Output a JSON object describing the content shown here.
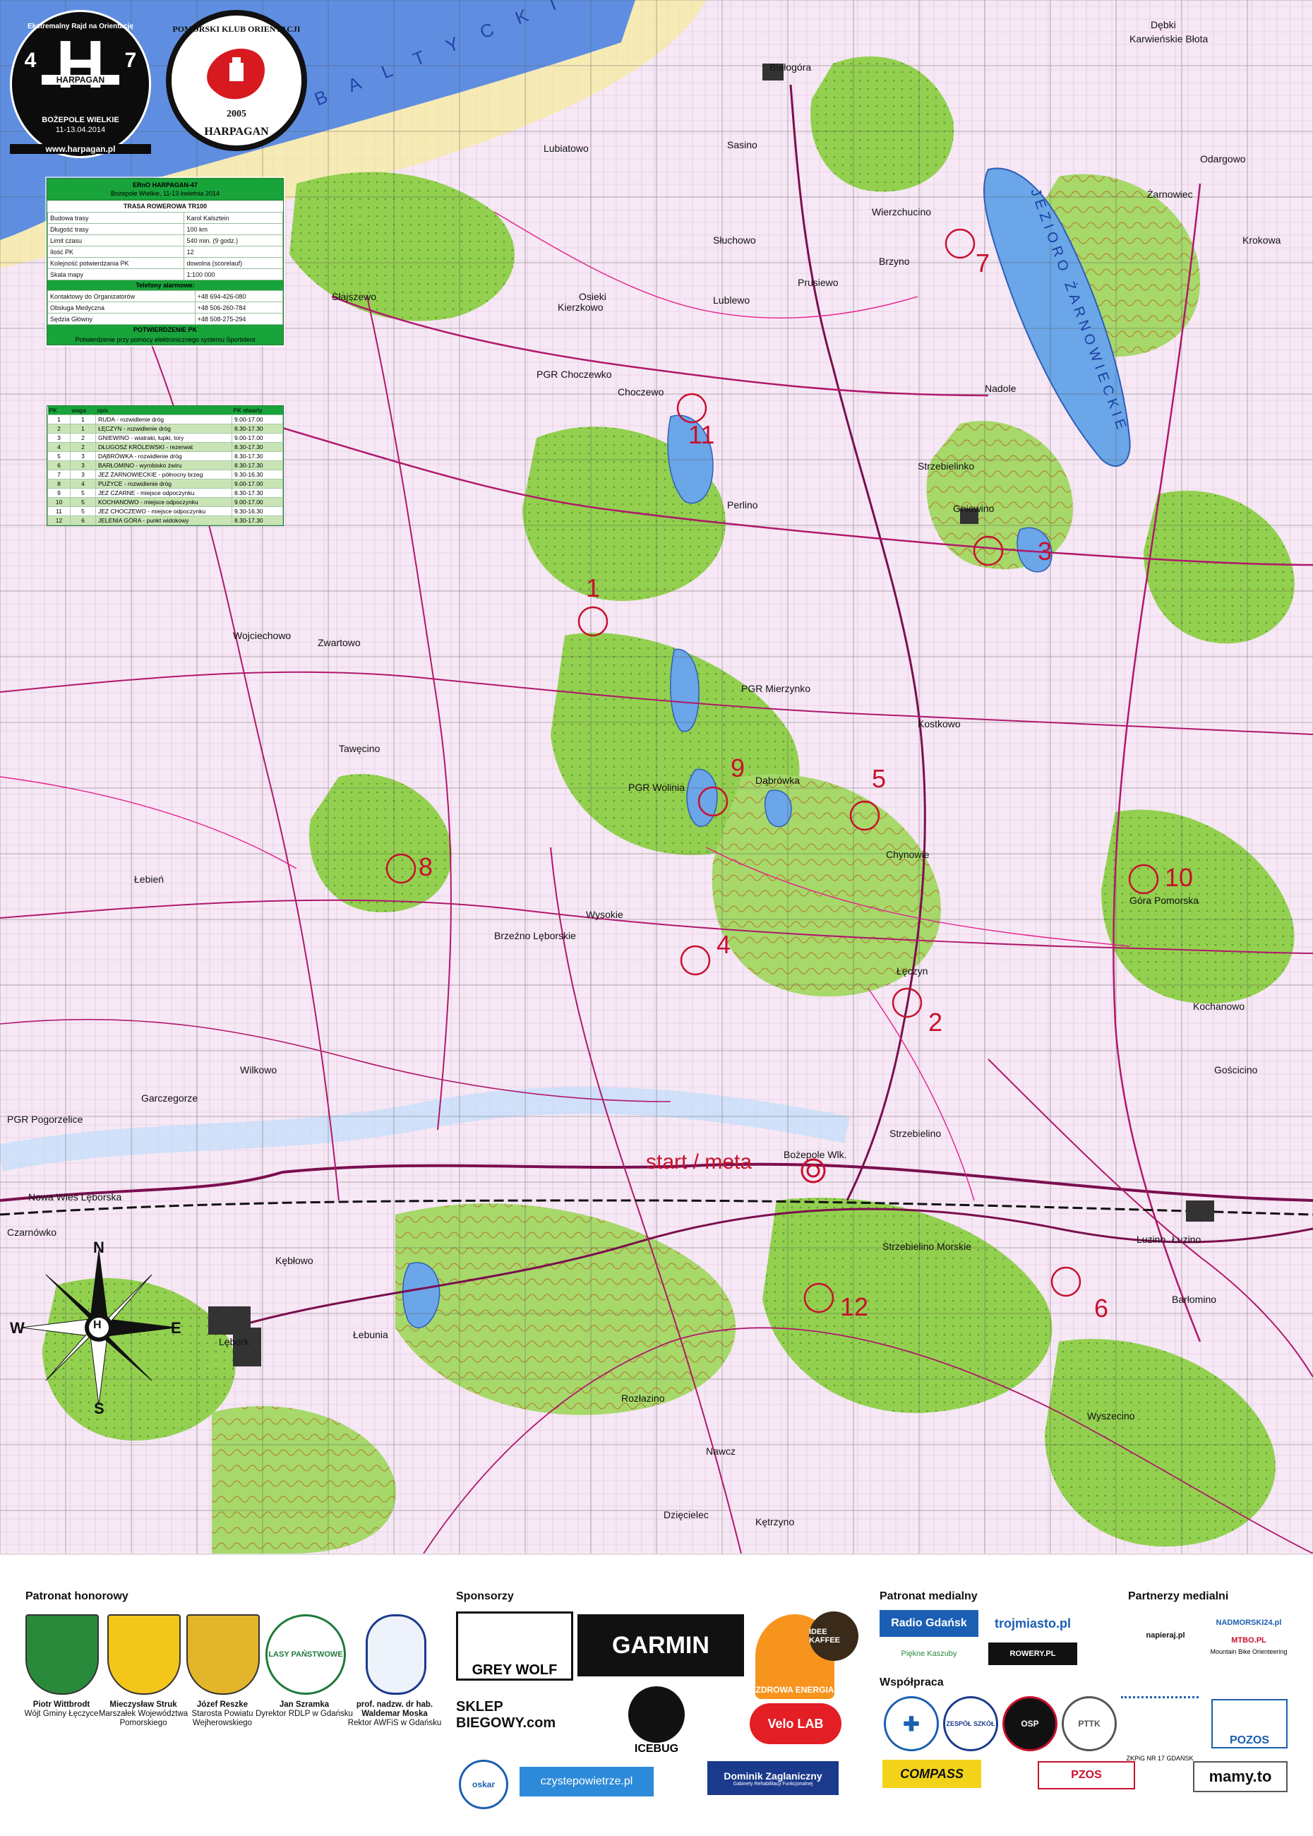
{
  "event_logo": {
    "ring_text": "Ekstremalny Rajd na Orientację",
    "left_digit": "4",
    "letter": "H",
    "right_digit": "7",
    "name": "HARPAGAN",
    "place": "BOŻEPOLE WIELKIE",
    "dates": "11-13.04.2014",
    "url": "www.harpagan.pl"
  },
  "club_logo": {
    "ring_text": "POMORSKI KLUB ORIENTACJI",
    "year": "2005",
    "name": "HARPAGAN"
  },
  "info_panel": {
    "title": "ERnO HARPAGAN-47",
    "subtitle": "Bożepole Wielkie, 11-13 kwietnia 2014",
    "route_title": "TRASA ROWEROWA TR100",
    "route_rows": [
      {
        "label": "Budowa trasy",
        "value": "Karol Kalsztein"
      },
      {
        "label": "Długość trasy",
        "value": "100 km"
      },
      {
        "label": "Limit czasu",
        "value": "540 min. (9 godz.)"
      },
      {
        "label": "Ilość PK",
        "value": "12"
      },
      {
        "label": "Kolejność potwierdzania PK",
        "value": "dowolna (scorelauf)"
      },
      {
        "label": "Skala mapy",
        "value": "1:100 000"
      }
    ],
    "phones_title": "Telefony alarmowe:",
    "phones": [
      {
        "label": "Kontaktowy do Organizatorów",
        "value": "+48 694-426-080"
      },
      {
        "label": "Obsługa Medyczna",
        "value": "+48 506-260-784"
      },
      {
        "label": "Sędzia Główny",
        "value": "+48 508-275-294"
      }
    ],
    "confirm_title": "POTWIERDZENIE PK",
    "confirm_text": "Potwierdzenie przy pomocy elektronicznego systemu Sportident"
  },
  "checkpoints": {
    "headers": [
      "PK",
      "waga",
      "opis",
      "PK otwarty"
    ],
    "rows": [
      {
        "pk": "1",
        "waga": "1",
        "opis": "RUDA - rozwidlenie dróg",
        "hours": "9.00-17.00"
      },
      {
        "pk": "2",
        "waga": "1",
        "opis": "ŁĘCZYN - rozwidlenie dróg",
        "hours": "8.30-17.30"
      },
      {
        "pk": "3",
        "waga": "2",
        "opis": "GNIEWINO - wiatraki, łupki, tory",
        "hours": "9.00-17.00"
      },
      {
        "pk": "4",
        "waga": "2",
        "opis": "DŁUGOSZ KRÓLEWSKI - rezerwat",
        "hours": "8.30-17.30"
      },
      {
        "pk": "5",
        "waga": "3",
        "opis": "DĄBRÓWKA - rozwidlenie dróg",
        "hours": "8.30-17.30"
      },
      {
        "pk": "6",
        "waga": "3",
        "opis": "BARŁOMINO - wyrobisko żwiru",
        "hours": "8.30-17.30"
      },
      {
        "pk": "7",
        "waga": "3",
        "opis": "JEZ ŻARNOWIECKIE - północny brzeg",
        "hours": "9.30-16.30"
      },
      {
        "pk": "8",
        "waga": "4",
        "opis": "PUŻYCE - rozwidlenie dróg",
        "hours": "9.00-17.00"
      },
      {
        "pk": "9",
        "waga": "5",
        "opis": "JEZ CZARNE - miejsce odpoczynku",
        "hours": "8.30-17.30"
      },
      {
        "pk": "10",
        "waga": "5",
        "opis": "KOCHANOWO - miejsce odpoczynku",
        "hours": "9.00-17.00"
      },
      {
        "pk": "11",
        "waga": "5",
        "opis": "JEZ CHOCZEWO - miejsce odpoczynku",
        "hours": "9.30-16.30"
      },
      {
        "pk": "12",
        "waga": "6",
        "opis": "JELENIA GÓRA - punkt widokowy",
        "hours": "8.30-17.30"
      }
    ]
  },
  "map": {
    "sea_label": "B A L T Y C K I E",
    "lake_label": "JEZIORO ŻARNOWIECKIE",
    "start_label": "start / meta",
    "checkpoint_numbers": [
      "1",
      "2",
      "3",
      "4",
      "5",
      "6",
      "7",
      "8",
      "9",
      "10",
      "11",
      "12"
    ],
    "places": [
      "Białogóra",
      "Karwieńskie Błota",
      "Dębki",
      "Wierzchucino",
      "Słuchowo",
      "Lubiatowo",
      "Sasino",
      "Słajszewo",
      "Osieki",
      "Kierzkowo",
      "Lublewo",
      "Prusiewo",
      "Brzyno",
      "Odargowo",
      "Krokowa",
      "Żarnowiec",
      "Nadole",
      "Choczewo",
      "Strzebielinko",
      "Gniewino",
      "PGR Choczewko",
      "Perlino",
      "Kostkowo",
      "Wojciechowo",
      "Zwartowo",
      "Tawęcino",
      "Łebień",
      "PGR Mierzynko",
      "PGR Wolinia",
      "Dąbrówka",
      "Chynowie",
      "Góra Pomorska",
      "Brzeźno Lęborskie",
      "Wysokie",
      "Łęczyn",
      "Kochanowo",
      "Wilkowo",
      "Garczegorze",
      "PGR Pogorzelice",
      "Strzebielino",
      "Bożepole Wlk.",
      "Strzebielino Morskie",
      "Łuzino",
      "Nowa Wieś Lęborska",
      "Czarnówko",
      "Kębłowo",
      "Lębork",
      "Łebunia",
      "Rozłazino",
      "Nawcz",
      "Dzięcielec",
      "Kętrzyno",
      "Wyszecino",
      "Barłomino",
      "Gościcino",
      "Luzino"
    ]
  },
  "compass": {
    "north": "N",
    "east": "E",
    "south": "S",
    "west": "W",
    "center": "H"
  },
  "sponsors": {
    "patronat_title": "Patronat honorowy",
    "patrons": [
      {
        "name": "Piotr Wittbrodt",
        "role": "Wójt Gminy Łęczyce"
      },
      {
        "name": "Mieczysław Struk",
        "role": "Marszałek Województwa Pomorskiego"
      },
      {
        "name": "Józef Reszke",
        "role": "Starosta Powiatu Wejherowskiego"
      },
      {
        "name": "Jan Szramka",
        "role": "Dyrektor RDLP w Gdańsku"
      },
      {
        "name": "prof. nadzw. dr hab. Waldemar Moska",
        "role": "Rektor AWFiS w Gdańsku"
      }
    ],
    "lasy_label": "LASY PAŃSTWOWE",
    "sponsorzy_title": "Sponsorzy",
    "sponsor_names": [
      "GREY WOLF",
      "GARMIN",
      "ZDROWA ENERGIA",
      "IDEE KAFFEE",
      "SKLEP BIEGOWY.com",
      "ICEBUG",
      "Velo LAB",
      "oskar",
      "czystepowietrze.pl",
      "Dominik Zaglaniczny",
      "Gabinety Rehabilitacji Funkcjonalnej"
    ],
    "media_title": "Patronat medialny",
    "media_names": [
      "Radio Gdańsk",
      "trojmiasto.pl",
      "Piękne Kaszuby",
      "ROWERY.PL"
    ],
    "wspolpraca_title": "Współpraca",
    "wspolpraca_names": [
      "COMPASS",
      "ZESPÓŁ SZKÓŁ",
      "OSP",
      "PTTK",
      "PZOS"
    ],
    "partners_title": "Partnerzy medialni",
    "partner_names": [
      "napieraj.pl",
      "NADMORSKI24.pl",
      "MTBO.PL",
      "Mountain Bike Orienteering",
      "ZKPiG NR 17 GDAŃSK",
      "POZOS",
      "mamy.to"
    ]
  }
}
